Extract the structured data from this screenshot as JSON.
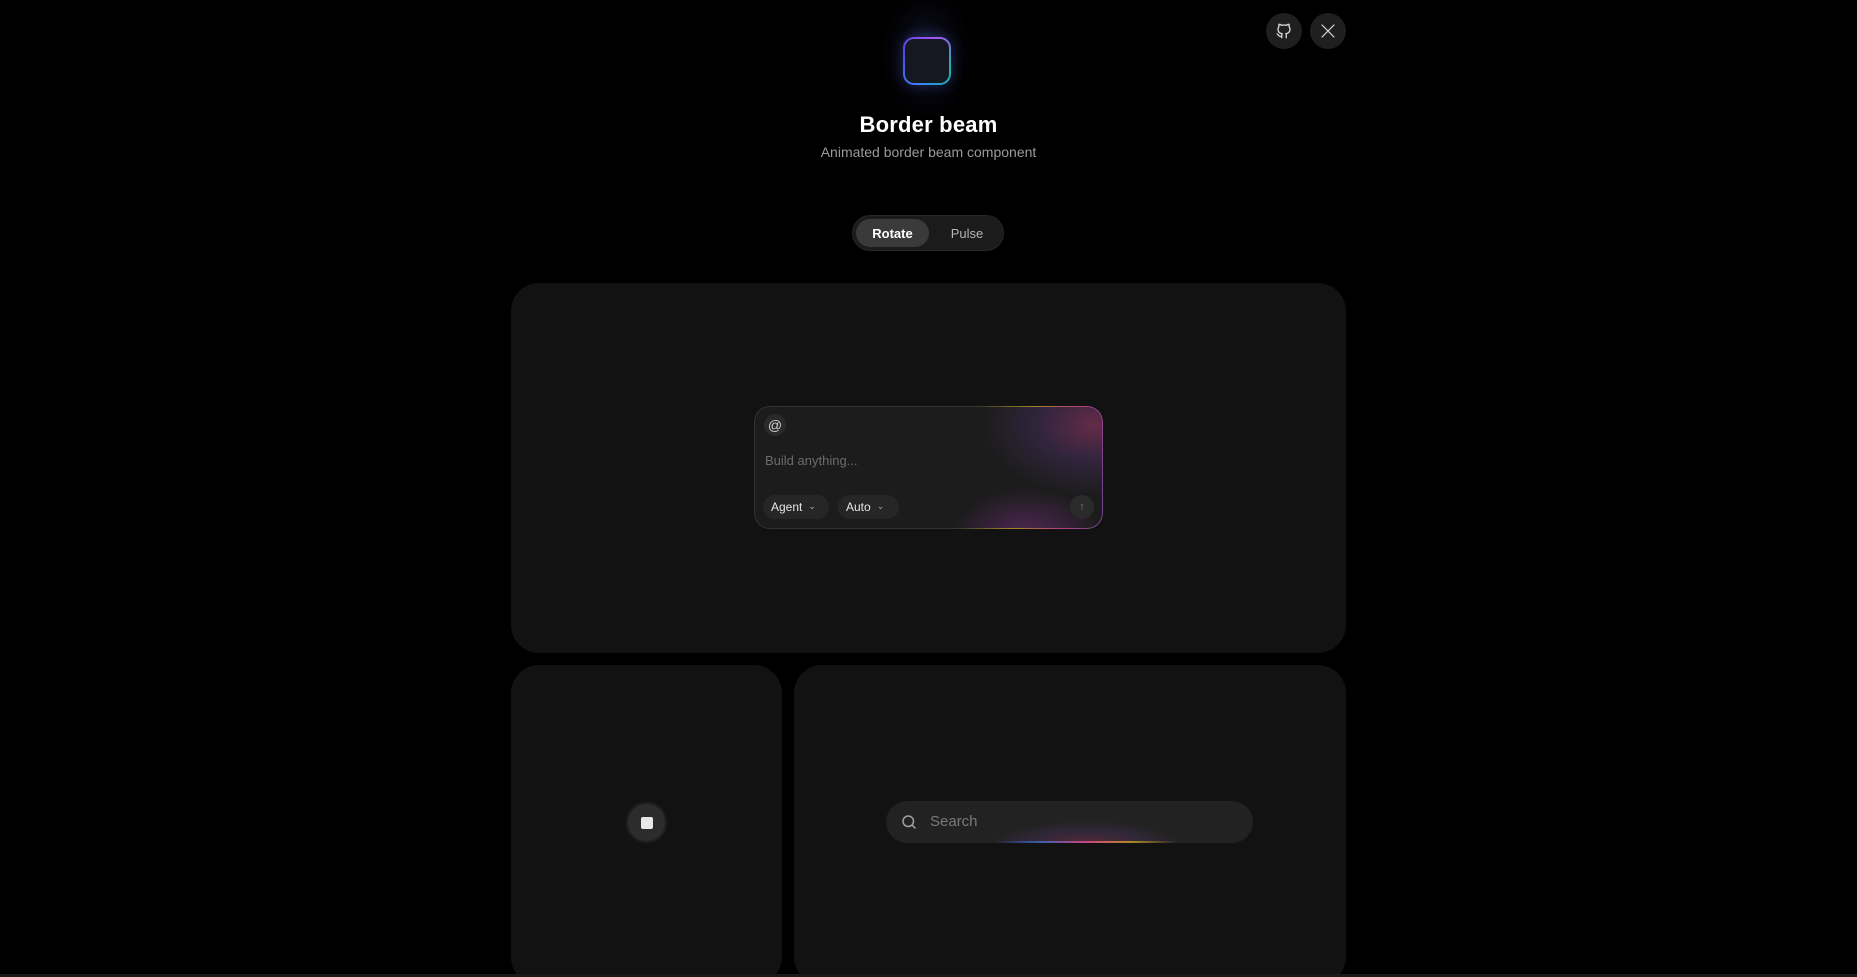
{
  "header": {
    "title": "Border beam",
    "subtitle": "Animated border beam component"
  },
  "social": {
    "github_icon": "github-icon",
    "x_icon": "x-icon"
  },
  "toggle": {
    "options": [
      "Rotate",
      "Pulse"
    ],
    "selected": "Rotate"
  },
  "composer": {
    "mention_symbol": "@",
    "placeholder": "Build anything...",
    "mode_label": "Agent",
    "model_label": "Auto",
    "send_icon": "arrow-up-icon"
  },
  "stop_button": {
    "icon": "stop-icon"
  },
  "search": {
    "placeholder": "Search",
    "icon": "search-icon"
  },
  "colors": {
    "background": "#000000",
    "card": "#121212",
    "beam_pink": "#ec4899",
    "beam_purple": "#a855f7",
    "beam_yellow": "#facc15",
    "beam_blue": "#3b82f6"
  }
}
